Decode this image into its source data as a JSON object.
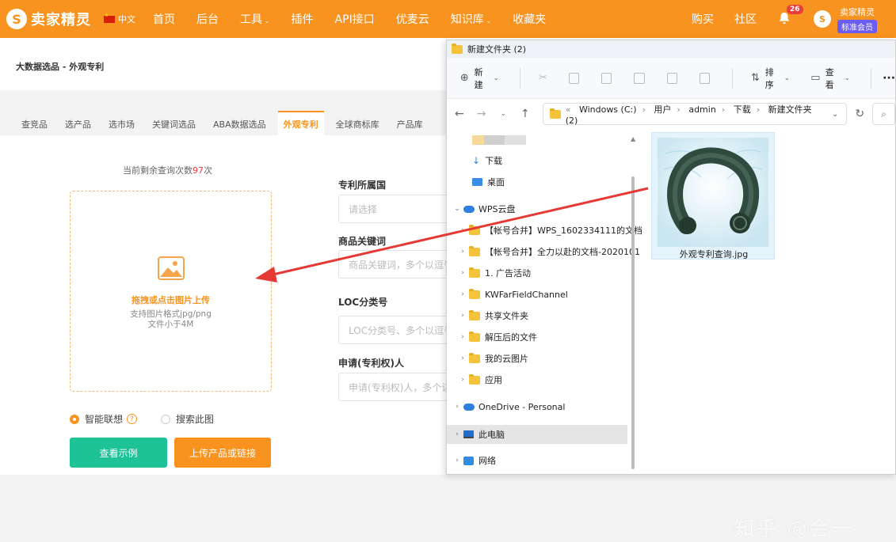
{
  "topnav": {
    "logo_text": "卖家精灵",
    "logo_mark": "S",
    "lang": "中文",
    "items": [
      {
        "label": "首页",
        "dropdown": false
      },
      {
        "label": "后台",
        "dropdown": false
      },
      {
        "label": "工具",
        "dropdown": true
      },
      {
        "label": "插件",
        "dropdown": false
      },
      {
        "label": "API接口",
        "dropdown": false
      },
      {
        "label": "优麦云",
        "dropdown": false
      },
      {
        "label": "知识库",
        "dropdown": true
      },
      {
        "label": "收藏夹",
        "dropdown": false
      }
    ],
    "right_items": [
      "购买",
      "社区"
    ],
    "notification_count": "26",
    "user_name": "卖家精灵",
    "member_badge": "标准会员",
    "avatar_mark": "S"
  },
  "breadcrumb": "大数据选品 - 外观专利",
  "tabs": [
    "查竞品",
    "选产品",
    "选市场",
    "关键词选品",
    "ABA数据选品",
    "外观专利",
    "全球商标库",
    "产品库"
  ],
  "active_tab": "外观专利",
  "remain": {
    "prefix": "当前剩余查询次数",
    "count": "97",
    "suffix": "次"
  },
  "upload": {
    "title": "拖拽或点击图片上传",
    "sub1": "支持图片格式jpg/png",
    "sub2": "文件小于4M"
  },
  "radios": {
    "option1": "智能联想",
    "help": "?",
    "option2": "搜索此图"
  },
  "buttons": {
    "example": "查看示例",
    "upload_link": "上传产品或链接"
  },
  "fields": [
    {
      "label": "专利所属国",
      "placeholder": "请选择"
    },
    {
      "label": "商品关键词",
      "placeholder": "商品关键词，多个以逗号"
    },
    {
      "label": "LOC分类号",
      "placeholder": "LOC分类号、多个以逗号"
    },
    {
      "label": "申请(专利权)人",
      "placeholder": "申请(专利权)人，多个读"
    }
  ],
  "explorer": {
    "title": "新建文件夹 (2)",
    "toolbar": {
      "new_label": "新建",
      "sort_label": "排序",
      "view_label": "查看",
      "more": "···"
    },
    "address": {
      "prefix": "«",
      "crumbs": [
        "Windows (C:)",
        "用户",
        "admin",
        "下载",
        "新建文件夹 (2)"
      ]
    },
    "tree": {
      "downloads": "下载",
      "desktop": "桌面",
      "wps": "WPS云盘",
      "folders": [
        "【帐号合并】WPS_1602334111的文档",
        "【帐号合并】全力以赴的文档-2020101",
        "1. 广告活动",
        "KWFarFieldChannel",
        "共享文件夹",
        "解压后的文件",
        "我的云图片",
        "应用"
      ],
      "onedrive": "OneDrive - Personal",
      "this_pc": "此电脑",
      "network": "网络"
    },
    "file": {
      "name": "外观专利查询.jpg"
    }
  },
  "watermark": "知乎 @会一",
  "colors": {
    "brand": "#f7931e",
    "green": "#1ec297",
    "member": "#6a5cf4",
    "arrow": "#e53935"
  }
}
